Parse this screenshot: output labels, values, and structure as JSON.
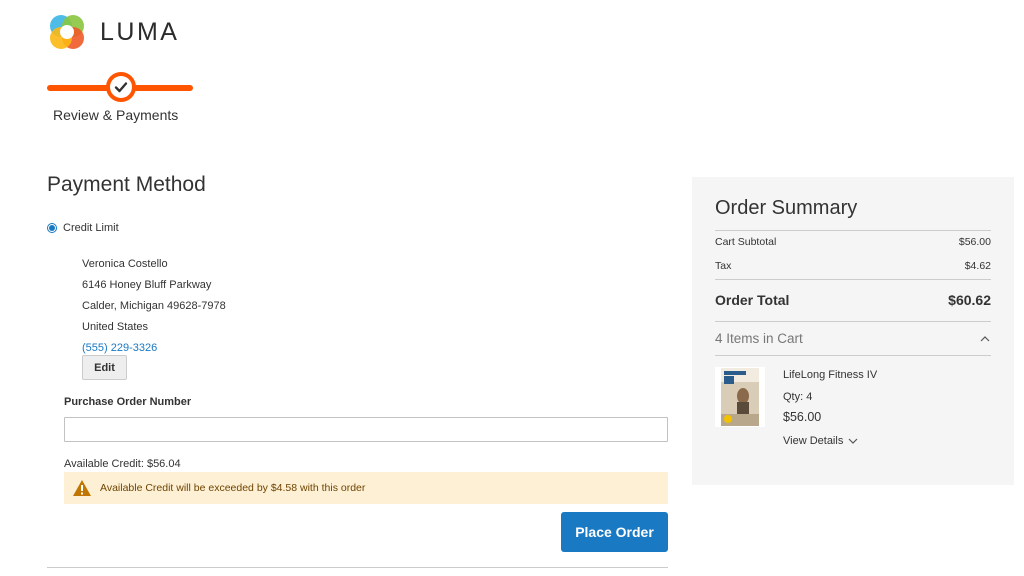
{
  "brand": {
    "name": "LUMA"
  },
  "progress": {
    "step_label": "Review & Payments"
  },
  "payment": {
    "title": "Payment Method",
    "method_label": "Credit Limit",
    "address": {
      "name": "Veronica Costello",
      "street": "6146 Honey Bluff Parkway",
      "city_line": "Calder, Michigan 49628-7978",
      "country": "United States",
      "phone": "(555) 229-3326"
    },
    "edit_label": "Edit",
    "po_label": "Purchase Order Number",
    "po_value": "",
    "available_credit": "Available Credit: $56.04",
    "warning": "Available Credit will be exceeded by $4.58 with this order",
    "place_order_label": "Place Order"
  },
  "summary": {
    "title": "Order Summary",
    "subtotal_label": "Cart Subtotal",
    "subtotal_value": "$56.00",
    "tax_label": "Tax",
    "tax_value": "$4.62",
    "total_label": "Order Total",
    "total_value": "$60.62",
    "items_label": "4 Items in Cart",
    "item": {
      "name": "LifeLong Fitness IV",
      "qty": "Qty: 4",
      "price": "$56.00",
      "details_label": "View Details"
    }
  },
  "colors": {
    "accent": "#ff5501",
    "primary": "#1979c3",
    "warning_bg": "#fdf0d5"
  },
  "icons": [
    "luma-logo-icon",
    "check-icon",
    "warning-icon",
    "chevron-up-icon",
    "chevron-down-icon"
  ]
}
